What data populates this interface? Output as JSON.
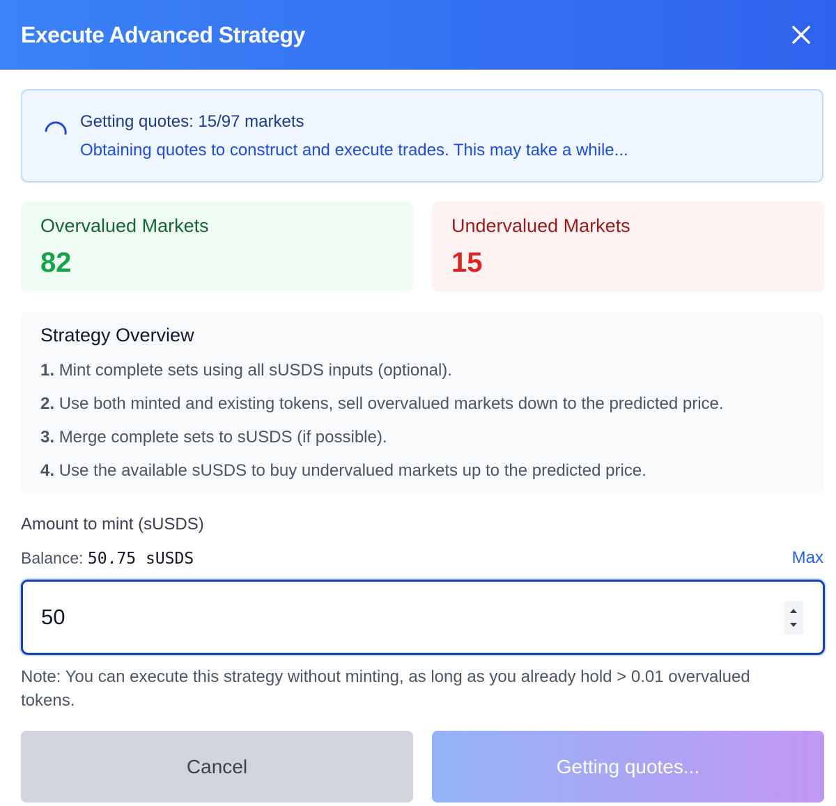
{
  "header": {
    "title": "Execute Advanced Strategy",
    "bg_color": "#3b82f6",
    "close_icon": "close-icon"
  },
  "progress": {
    "title": "Getting quotes: 15/97 markets",
    "message": "Obtaining quotes to construct and execute trades. This may take a while...",
    "spinner_icon": "spinner-icon"
  },
  "stats": {
    "overvalued": {
      "label": "Overvalued Markets",
      "value": "82",
      "color": "#16a34a"
    },
    "undervalued": {
      "label": "Undervalued Markets",
      "value": "15",
      "color": "#dc2626"
    }
  },
  "overview": {
    "title": "Strategy Overview",
    "steps": [
      {
        "num": "1.",
        "text": "Mint complete sets using all sUSDS inputs (optional)."
      },
      {
        "num": "2.",
        "text": "Use both minted and existing tokens, sell overvalued markets down to the predicted price."
      },
      {
        "num": "3.",
        "text": "Merge complete sets to sUSDS (if possible)."
      },
      {
        "num": "4.",
        "text": "Use the available sUSDS to buy undervalued markets up to the predicted price."
      }
    ]
  },
  "amount": {
    "label": "Amount to mint (sUSDS)",
    "balance_label": "Balance:",
    "balance_value": "50.75 sUSDS",
    "max_label": "Max",
    "value": "50"
  },
  "note": "Note: You can execute this strategy without minting, as long as you already hold > 0.01 overvalued tokens.",
  "buttons": {
    "cancel": "Cancel",
    "execute": "Getting quotes..."
  }
}
